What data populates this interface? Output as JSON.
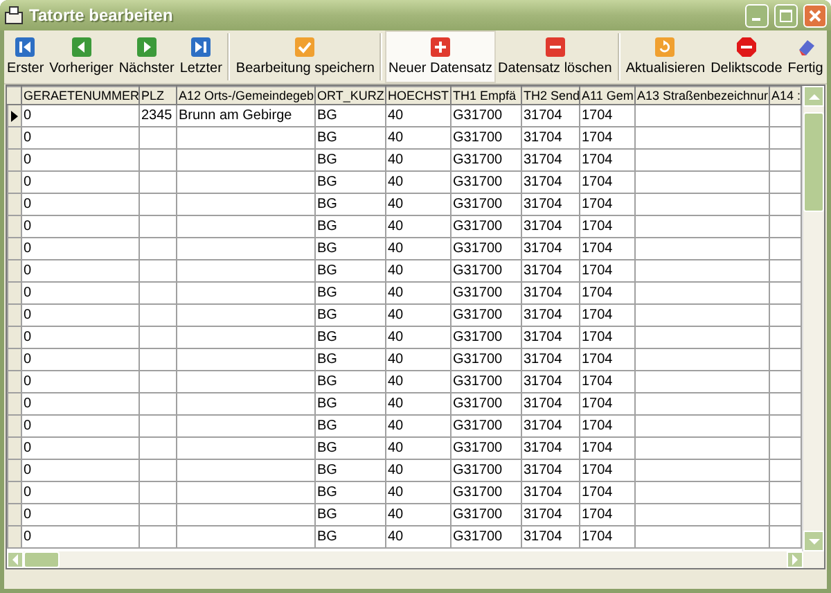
{
  "window": {
    "title": "Tatorte bearbeiten"
  },
  "toolbar": [
    {
      "label": "Erster",
      "kind": "first",
      "highlighted": false
    },
    {
      "label": "Vorheriger",
      "kind": "previous",
      "highlighted": false
    },
    {
      "label": "Nächster",
      "kind": "next",
      "highlighted": false
    },
    {
      "label": "Letzter",
      "kind": "last",
      "highlighted": false
    },
    {
      "label": "Bearbeitung speichern",
      "kind": "save",
      "highlighted": false
    },
    {
      "label": "Neuer Datensatz",
      "kind": "new",
      "highlighted": true
    },
    {
      "label": "Datensatz löschen",
      "kind": "delete",
      "highlighted": false
    },
    {
      "label": "Aktualisieren",
      "kind": "refresh",
      "highlighted": false
    },
    {
      "label": "Deliktscode",
      "kind": "stop",
      "highlighted": false
    },
    {
      "label": "Fertig",
      "kind": "done",
      "highlighted": false
    }
  ],
  "table": {
    "columns": [
      "GERAETENUMMER",
      "PLZ",
      "A12 Orts-/Gemeindegeb",
      "ORT_KURZ",
      "HOECHST",
      "TH1 Empfä",
      "TH2 Send",
      "A11 Gem",
      "A13 Straßenbezeichnur",
      "A14 :"
    ],
    "rows": [
      {
        "selected": true,
        "cells": [
          "0",
          "2345",
          "Brunn am Gebirge",
          "BG",
          "40",
          "G31700",
          "31704",
          "1704"
        ]
      },
      {
        "selected": false,
        "cells": [
          "0",
          "",
          "",
          "BG",
          "40",
          "G31700",
          "31704",
          "1704"
        ]
      },
      {
        "selected": false,
        "cells": [
          "0",
          "",
          "",
          "BG",
          "40",
          "G31700",
          "31704",
          "1704"
        ]
      },
      {
        "selected": false,
        "cells": [
          "0",
          "",
          "",
          "BG",
          "40",
          "G31700",
          "31704",
          "1704"
        ]
      },
      {
        "selected": false,
        "cells": [
          "0",
          "",
          "",
          "BG",
          "40",
          "G31700",
          "31704",
          "1704"
        ]
      },
      {
        "selected": false,
        "cells": [
          "0",
          "",
          "",
          "BG",
          "40",
          "G31700",
          "31704",
          "1704"
        ]
      },
      {
        "selected": false,
        "cells": [
          "0",
          "",
          "",
          "BG",
          "40",
          "G31700",
          "31704",
          "1704"
        ]
      },
      {
        "selected": false,
        "cells": [
          "0",
          "",
          "",
          "BG",
          "40",
          "G31700",
          "31704",
          "1704"
        ]
      },
      {
        "selected": false,
        "cells": [
          "0",
          "",
          "",
          "BG",
          "40",
          "G31700",
          "31704",
          "1704"
        ]
      },
      {
        "selected": false,
        "cells": [
          "0",
          "",
          "",
          "BG",
          "40",
          "G31700",
          "31704",
          "1704"
        ]
      },
      {
        "selected": false,
        "cells": [
          "0",
          "",
          "",
          "BG",
          "40",
          "G31700",
          "31704",
          "1704"
        ]
      },
      {
        "selected": false,
        "cells": [
          "0",
          "",
          "",
          "BG",
          "40",
          "G31700",
          "31704",
          "1704"
        ]
      },
      {
        "selected": false,
        "cells": [
          "0",
          "",
          "",
          "BG",
          "40",
          "G31700",
          "31704",
          "1704"
        ]
      },
      {
        "selected": false,
        "cells": [
          "0",
          "",
          "",
          "BG",
          "40",
          "G31700",
          "31704",
          "1704"
        ]
      },
      {
        "selected": false,
        "cells": [
          "0",
          "",
          "",
          "BG",
          "40",
          "G31700",
          "31704",
          "1704"
        ]
      },
      {
        "selected": false,
        "cells": [
          "0",
          "",
          "",
          "BG",
          "40",
          "G31700",
          "31704",
          "1704"
        ]
      },
      {
        "selected": false,
        "cells": [
          "0",
          "",
          "",
          "BG",
          "40",
          "G31700",
          "31704",
          "1704"
        ]
      },
      {
        "selected": false,
        "cells": [
          "0",
          "",
          "",
          "BG",
          "40",
          "G31700",
          "31704",
          "1704"
        ]
      },
      {
        "selected": false,
        "cells": [
          "0",
          "",
          "",
          "BG",
          "40",
          "G31700",
          "31704",
          "1704"
        ]
      },
      {
        "selected": false,
        "cells": [
          "0",
          "",
          "",
          "BG",
          "40",
          "G31700",
          "31704",
          "1704"
        ]
      }
    ]
  }
}
